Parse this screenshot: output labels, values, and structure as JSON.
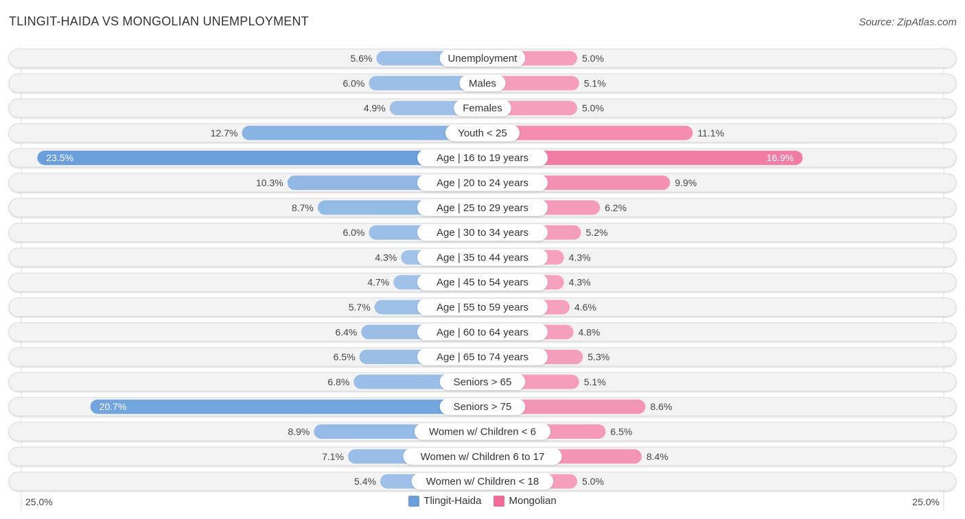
{
  "header": {
    "title": "TLINGIT-HAIDA VS MONGOLIAN UNEMPLOYMENT",
    "source": "Source: ZipAtlas.com"
  },
  "axis": {
    "left_label": "25.0%",
    "right_label": "25.0%"
  },
  "legend": [
    {
      "name": "Tlingit-Haida",
      "color": "#6a9fdc"
    },
    {
      "name": "Mongolian",
      "color": "#f06a97"
    }
  ],
  "chart_data": {
    "type": "bar",
    "orientation": "horizontal-diverging",
    "title": "TLINGIT-HAIDA VS MONGOLIAN UNEMPLOYMENT",
    "xlim": [
      -25.0,
      25.0
    ],
    "unit": "%",
    "legend_position": "bottom-center",
    "categories": [
      "Unemployment",
      "Males",
      "Females",
      "Youth < 25",
      "Age | 16 to 19 years",
      "Age | 20 to 24 years",
      "Age | 25 to 29 years",
      "Age | 30 to 34 years",
      "Age | 35 to 44 years",
      "Age | 45 to 54 years",
      "Age | 55 to 59 years",
      "Age | 60 to 64 years",
      "Age | 65 to 74 years",
      "Seniors > 65",
      "Seniors > 75",
      "Women w/ Children < 6",
      "Women w/ Children 6 to 17",
      "Women w/ Children < 18"
    ],
    "series": [
      {
        "name": "Tlingit-Haida",
        "side": "left",
        "color": "#6a9fdc",
        "values": [
          5.6,
          6.0,
          4.9,
          12.7,
          23.5,
          10.3,
          8.7,
          6.0,
          4.3,
          4.7,
          5.7,
          6.4,
          6.5,
          6.8,
          20.7,
          8.9,
          7.1,
          5.4
        ]
      },
      {
        "name": "Mongolian",
        "side": "right",
        "color": "#f06a97",
        "values": [
          5.0,
          5.1,
          5.0,
          11.1,
          16.9,
          9.9,
          6.2,
          5.2,
          4.3,
          4.3,
          4.6,
          4.8,
          5.3,
          5.1,
          8.6,
          6.5,
          8.4,
          5.0
        ]
      }
    ]
  }
}
